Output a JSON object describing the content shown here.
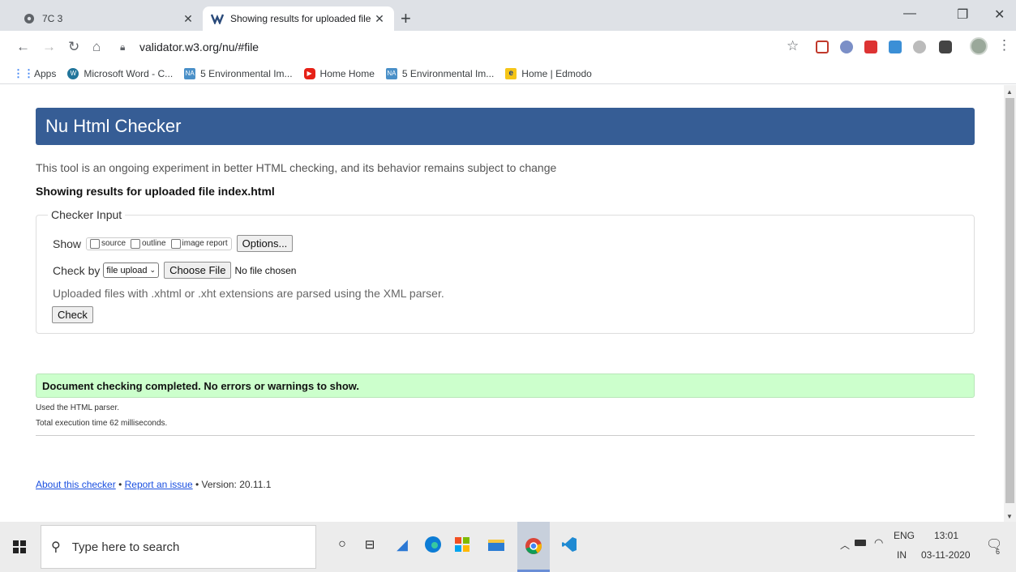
{
  "browser": {
    "tabs": [
      {
        "title": "7C 3",
        "active": false
      },
      {
        "title": "Showing results for uploaded file",
        "active": true
      }
    ],
    "new_tab": "+",
    "url": "validator.w3.org/nu/#file",
    "bookmarks": [
      {
        "label": "Apps",
        "icon": "apps-grid-icon"
      },
      {
        "label": "Microsoft Word - C...",
        "icon": "wordpress-icon"
      },
      {
        "label": "5 Environmental Im...",
        "icon": "na-icon"
      },
      {
        "label": "Home Home",
        "icon": "youtube-icon"
      },
      {
        "label": "5 Environmental Im...",
        "icon": "na-icon"
      },
      {
        "label": "Home | Edmodo",
        "icon": "edmodo-icon"
      }
    ]
  },
  "page": {
    "heading": "Nu Html Checker",
    "intro": "This tool is an ongoing experiment in better HTML checking, and its behavior remains subject to change",
    "results_for": "Showing results for uploaded file index.html",
    "checker_input": {
      "legend": "Checker Input",
      "show_label": "Show",
      "show_options": [
        "source",
        "outline",
        "image report"
      ],
      "options_button": "Options...",
      "check_by_label": "Check by",
      "check_by_value": "file upload",
      "choose_file_button": "Choose File",
      "no_file": "No file chosen",
      "xml_note": "Uploaded files with .xhtml or .xht extensions are parsed using the XML parser.",
      "check_button": "Check"
    },
    "result_message": "Document checking completed. No errors or warnings to show.",
    "parser_note": "Used the HTML parser.",
    "exec_time": "Total execution time 62 milliseconds.",
    "footer": {
      "about_link": "About this checker",
      "sep": "•",
      "report_link": "Report an issue",
      "version": "• Version: 20.11.1"
    }
  },
  "taskbar": {
    "search_placeholder": "Type here to search",
    "lang_top": "ENG",
    "lang_bottom": "IN",
    "time": "13:01",
    "date": "03-11-2020",
    "notifications": "6"
  },
  "colors": {
    "header_bg": "#365d95",
    "success_bg": "#ccffcc",
    "link": "#1a4fe0"
  }
}
